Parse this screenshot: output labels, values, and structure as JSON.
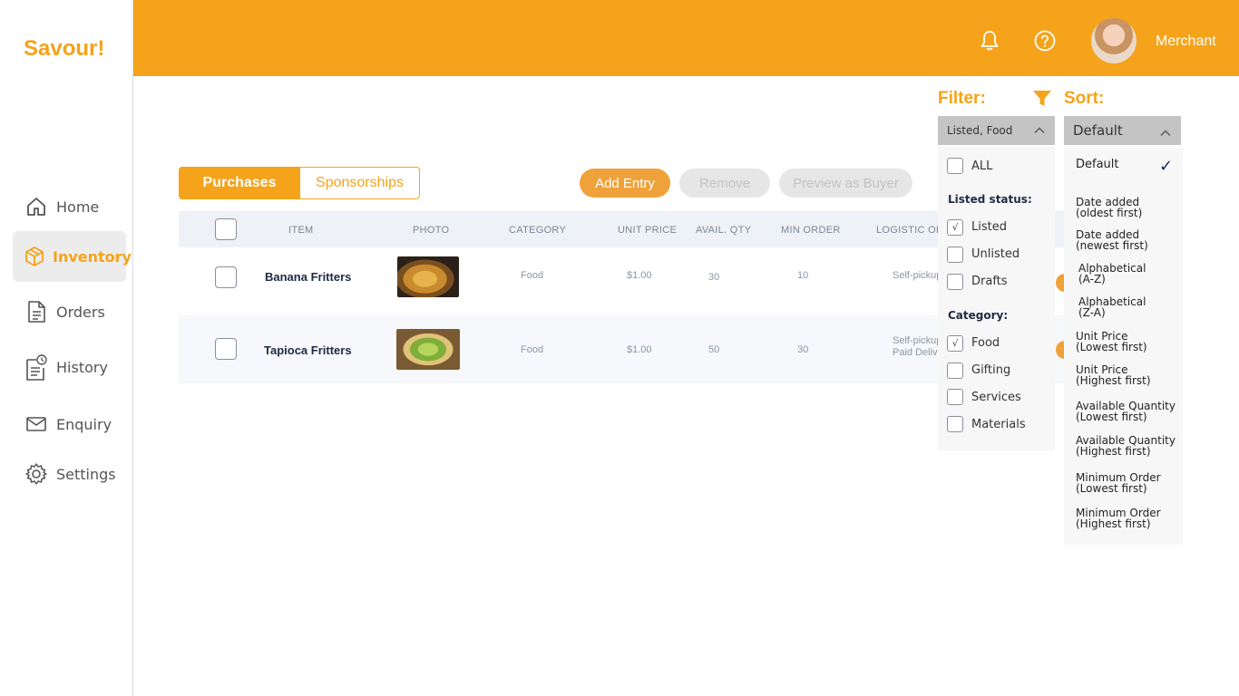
{
  "app": {
    "logo": "Savour!"
  },
  "sidebar": {
    "items": [
      {
        "label": "Home",
        "icon": "home-icon"
      },
      {
        "label": "Inventory",
        "icon": "box-icon"
      },
      {
        "label": "Orders",
        "icon": "document-icon"
      },
      {
        "label": "History",
        "icon": "history-icon"
      },
      {
        "label": "Enquiry",
        "icon": "mail-icon"
      },
      {
        "label": "Settings",
        "icon": "gear-icon"
      }
    ],
    "active": "Inventory"
  },
  "header": {
    "user_label": "Merchant",
    "accent": "#f5a31a"
  },
  "tabs": {
    "purchases": "Purchases",
    "sponsorships": "Sponsorships",
    "active": "Purchases"
  },
  "actions": {
    "add_entry": "Add Entry",
    "remove": "Remove",
    "preview": "Preview as Buyer"
  },
  "table": {
    "columns": [
      "ITEM",
      "PHOTO",
      "CATEGORY",
      "UNIT PRICE",
      "AVAIL. QTY",
      "MIN ORDER",
      "LOGISTIC OF"
    ],
    "rows": [
      {
        "item": "Banana Fritters",
        "category": "Food",
        "unit_price": "$1.00",
        "avail_qty": "30",
        "min_order": "10",
        "logistic_1": "Self-pickup",
        "logistic_2": ""
      },
      {
        "item": "Tapioca Fritters",
        "category": "Food",
        "unit_price": "$1.00",
        "avail_qty": "50",
        "min_order": "30",
        "logistic_1": "Self-pickup",
        "logistic_2": "Paid Deliv"
      }
    ]
  },
  "filter": {
    "label": "Filter:",
    "selected": "Listed, Food",
    "all_label": "ALL",
    "status_heading": "Listed status:",
    "status_options": [
      {
        "label": "Listed",
        "checked": true
      },
      {
        "label": "Unlisted",
        "checked": false
      },
      {
        "label": "Drafts",
        "checked": false
      }
    ],
    "category_heading": "Category:",
    "category_options": [
      {
        "label": "Food",
        "checked": true
      },
      {
        "label": "Gifting",
        "checked": false
      },
      {
        "label": "Services",
        "checked": false
      },
      {
        "label": "Materials",
        "checked": false
      }
    ],
    "check_glyph": "√"
  },
  "sort": {
    "label": "Sort:",
    "selected": "Default",
    "check_glyph": "✓",
    "options": [
      "Default",
      "Date added\n(oldest first)",
      "Date added\n(newest first)",
      "Alphabetical\n(A-Z)",
      "Alphabetical\n(Z-A)",
      "Unit Price\n(Lowest first)",
      "Unit Price\n(Highest first)",
      "Available Quantity\n(Lowest first)",
      "Available Quantity\n(Highest first)",
      "Minimum Order\n(Lowest first)",
      "Minimum Order\n(Highest first)"
    ]
  }
}
